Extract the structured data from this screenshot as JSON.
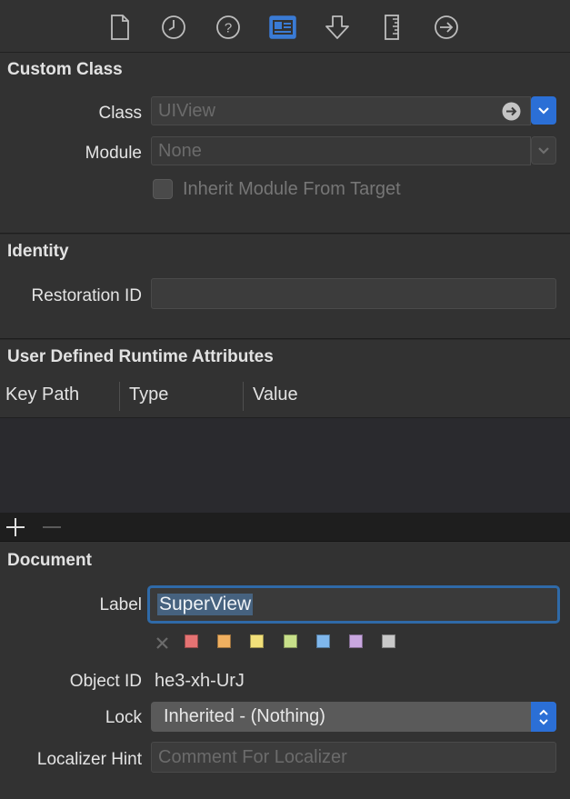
{
  "toolbar": {
    "icons": [
      "file-inspector-icon",
      "history-inspector-icon",
      "quick-help-icon",
      "identity-inspector-icon",
      "attributes-inspector-icon",
      "size-inspector-icon",
      "connections-inspector-icon"
    ],
    "selected": "identity-inspector-icon"
  },
  "custom_class": {
    "title": "Custom Class",
    "class_label": "Class",
    "class_placeholder": "UIView",
    "module_label": "Module",
    "module_placeholder": "None",
    "inherit_label": "Inherit Module From Target",
    "inherit_checked": false
  },
  "identity": {
    "title": "Identity",
    "restoration_label": "Restoration ID",
    "restoration_value": ""
  },
  "runtime_attributes": {
    "title": "User Defined Runtime Attributes",
    "columns": [
      "Key Path",
      "Type",
      "Value"
    ],
    "rows": []
  },
  "document": {
    "title": "Document",
    "label_label": "Label",
    "label_value": "SuperView",
    "clear_color_icon": "x-icon",
    "swatches": [
      "#e57373",
      "#f0b060",
      "#f2e07a",
      "#c8e08a",
      "#7fb7ec",
      "#c9a7e0",
      "#c9c9c9"
    ],
    "object_id_label": "Object ID",
    "object_id_value": "he3-xh-UrJ",
    "lock_label": "Lock",
    "lock_value": "Inherited - (Nothing)",
    "localizer_label": "Localizer Hint",
    "localizer_placeholder": "Comment For Localizer"
  },
  "colors": {
    "accent": "#2b6fd6",
    "background": "#323232",
    "focus_ring": "#2f6aa8"
  }
}
